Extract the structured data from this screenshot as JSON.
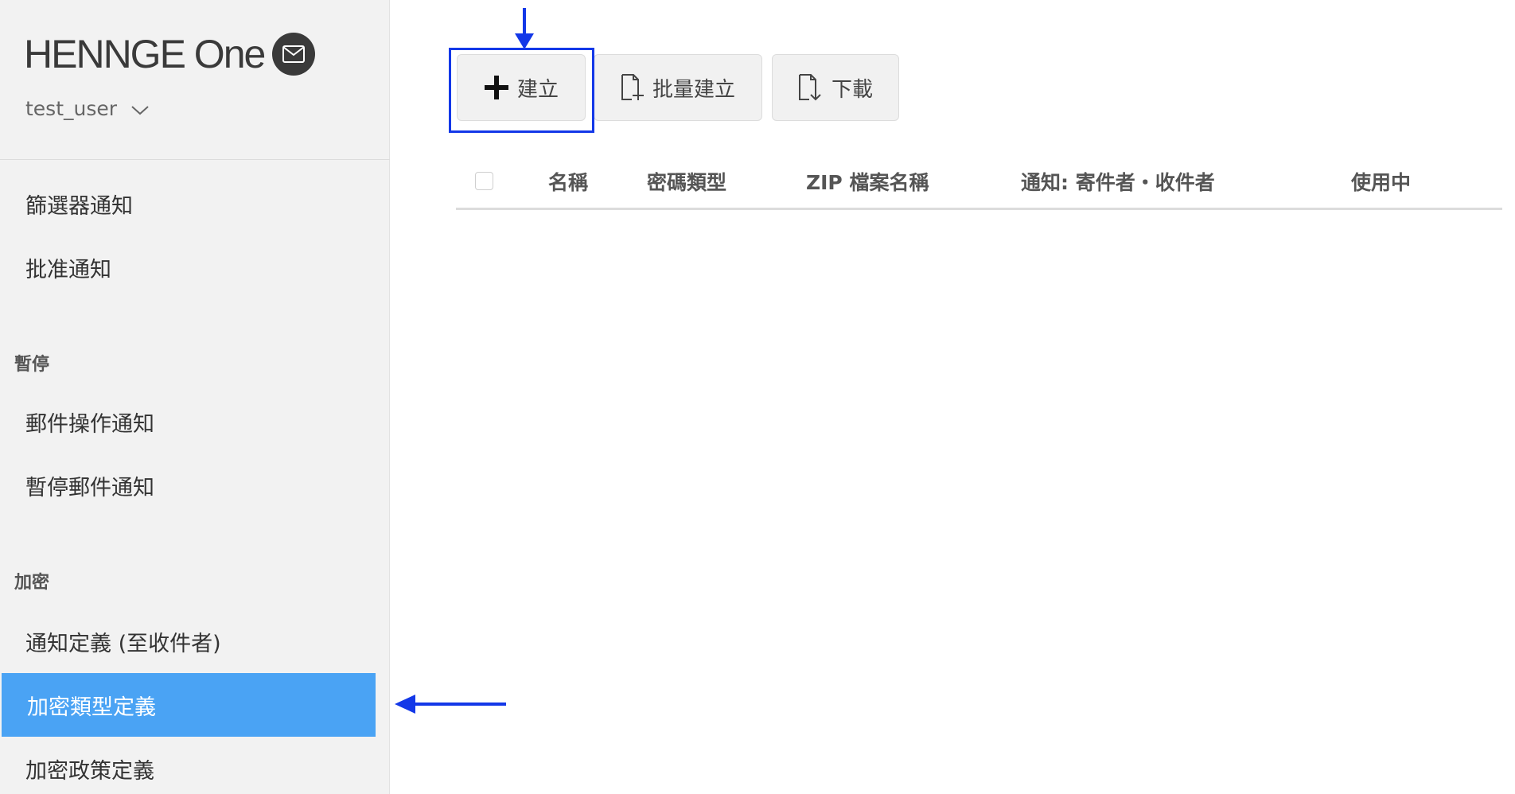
{
  "brand": {
    "name": "HENNGE One"
  },
  "user": {
    "name": "test_user"
  },
  "sidebar": {
    "items_top": [
      {
        "label": "篩選器通知"
      },
      {
        "label": "批准通知"
      }
    ],
    "sections": [
      {
        "title": "暫停",
        "items": [
          {
            "label": "郵件操作通知"
          },
          {
            "label": "暫停郵件通知"
          }
        ]
      },
      {
        "title": "加密",
        "items": [
          {
            "label": "通知定義 (至收件者)"
          },
          {
            "label": "加密類型定義",
            "active": true
          },
          {
            "label": "加密政策定義"
          }
        ]
      }
    ]
  },
  "toolbar": {
    "create_label": "建立",
    "bulk_create_label": "批量建立",
    "download_label": "下載"
  },
  "table": {
    "columns": [
      "名稱",
      "密碼類型",
      "ZIP 檔案名稱",
      "通知: 寄件者・收件者",
      "使用中"
    ]
  },
  "colors": {
    "active_nav": "#4aa3f4",
    "annotation": "#1338e8",
    "sidebar_bg": "#f2f2f2"
  }
}
